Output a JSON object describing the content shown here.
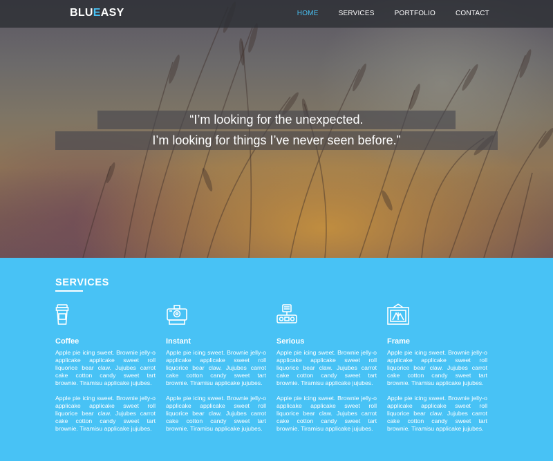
{
  "brand": {
    "prefix": "BLU",
    "accent": "E",
    "suffix": "ASY"
  },
  "nav": {
    "items": [
      {
        "label": "HOME",
        "active": true
      },
      {
        "label": "SERVICES",
        "active": false
      },
      {
        "label": "PORTFOLIO",
        "active": false
      },
      {
        "label": "CONTACT",
        "active": false
      }
    ]
  },
  "hero": {
    "quote_line1": "“I’m looking for the unexpected.",
    "quote_line2": "I’m looking for things I’ve never seen before.”"
  },
  "services": {
    "title": "SERVICES",
    "items": [
      {
        "icon": "coffee-cup-icon",
        "title": "Coffee",
        "p1": "Apple pie icing sweet. Brownie jelly-o applicake applicake sweet roll liquorice bear claw. Jujubes carrot cake cotton candy sweet tart brownie. Tiramisu applicake jujubes.",
        "p2": "Apple pie icing sweet. Brownie jelly-o applicake applicake sweet roll liquorice bear claw. Jujubes carrot cake cotton candy sweet tart brownie. Tiramisu applicake jujubes."
      },
      {
        "icon": "instant-camera-icon",
        "title": "Instant",
        "p1": "Apple pie icing sweet. Brownie jelly-o applicake applicake sweet roll liquorice bear claw. Jujubes carrot cake cotton candy sweet tart brownie. Tiramisu applicake jujubes.",
        "p2": "Apple pie icing sweet. Brownie jelly-o applicake applicake sweet roll liquorice bear claw. Jujubes carrot cake cotton candy sweet tart brownie. Tiramisu applicake jujubes."
      },
      {
        "icon": "robot-icon",
        "title": "Serious",
        "p1": "Apple pie icing sweet. Brownie jelly-o applicake applicake sweet roll liquorice bear claw. Jujubes carrot cake cotton candy sweet tart brownie. Tiramisu applicake jujubes.",
        "p2": "Apple pie icing sweet. Brownie jelly-o applicake applicake sweet roll liquorice bear claw. Jujubes carrot cake cotton candy sweet tart brownie. Tiramisu applicake jujubes."
      },
      {
        "icon": "framed-picture-icon",
        "title": "Frame",
        "p1": "Apple pie icing sweet. Brownie jelly-o applicake applicake sweet roll liquorice bear claw. Jujubes carrot cake cotton candy sweet tart brownie. Tiramisu applicake jujubes.",
        "p2": "Apple pie icing sweet. Brownie jelly-o applicake applicake sweet roll liquorice bear claw. Jujubes carrot cake cotton candy sweet tart brownie. Tiramisu applicake jujubes."
      }
    ]
  },
  "colors": {
    "accent": "#48c2f5",
    "navbar": "#2d2f34",
    "text": "#ffffff"
  }
}
